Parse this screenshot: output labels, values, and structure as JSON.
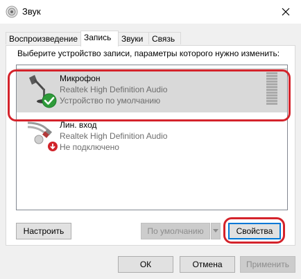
{
  "window": {
    "title": "Звук",
    "title_icon": "speaker-icon",
    "close_icon": "close-icon"
  },
  "tabs": [
    {
      "label": "Воспроизведение",
      "active": false
    },
    {
      "label": "Запись",
      "active": true
    },
    {
      "label": "Звуки",
      "active": false
    },
    {
      "label": "Связь",
      "active": false
    }
  ],
  "instruction": "Выберите устройство записи, параметры которого нужно изменить:",
  "devices": [
    {
      "name": "Микрофон",
      "driver": "Realtek High Definition Audio",
      "status": "Устройство по умолчанию",
      "icon": "microphone-icon",
      "badge": "default-check-icon",
      "selected": true
    },
    {
      "name": "Лин. вход",
      "driver": "Realtek High Definition Audio",
      "status": "Не подключено",
      "icon": "line-in-cable-icon",
      "badge": "disconnected-arrow-icon",
      "selected": false
    }
  ],
  "buttons": {
    "configure": "Настроить",
    "set_default": "По умолчанию",
    "properties": "Свойства",
    "ok": "ОК",
    "cancel": "Отмена",
    "apply": "Применить"
  },
  "colors": {
    "highlight": "#d4232b",
    "selected_row": "#d9d9d9",
    "check_green": "#2e9b3a",
    "disconnected_red": "#d1232a"
  }
}
